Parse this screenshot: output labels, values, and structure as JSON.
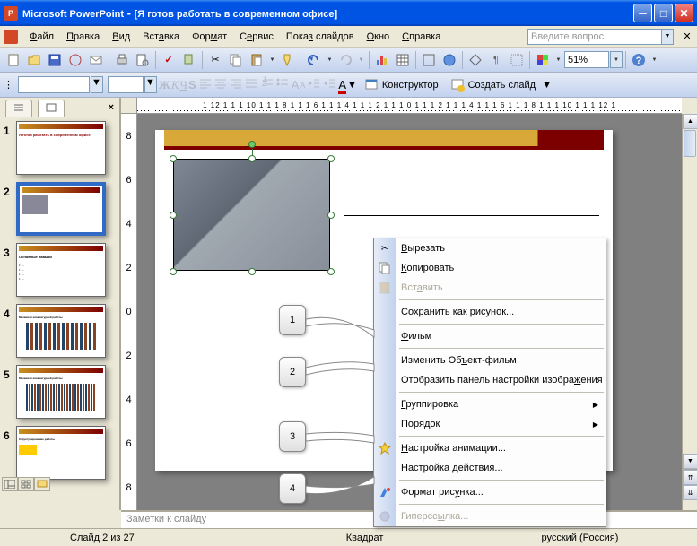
{
  "app": {
    "name": "Microsoft PowerPoint",
    "document": "[Я готов работать в современном офисе]"
  },
  "menu": {
    "file": "Файл",
    "edit": "Правка",
    "view": "Вид",
    "insert": "Вставка",
    "format": "Формат",
    "tools": "Сервис",
    "slideshow": "Показ слайдов",
    "window": "Окно",
    "help": "Справка",
    "ask_placeholder": "Введите вопрос"
  },
  "toolbar": {
    "zoom": "51%",
    "designer": "Конструктор",
    "newslide": "Создать слайд"
  },
  "ruler_h": "1 12 1 1 1 10 1 1 1 8 1 1 1 6 1 1 1 4 1 1 1 2 1 1 1 0 1 1 1 2 1 1 1 4 1 1 1 6 1 1 1 8 1 1 1 10 1 1 1 12 1",
  "ruler_v": [
    "8",
    "6",
    "4",
    "2",
    "0",
    "2",
    "4",
    "6",
    "8"
  ],
  "thumbs": {
    "count": 6,
    "selected": 2
  },
  "context_menu": {
    "cut": "Вырезать",
    "copy": "Копировать",
    "paste": "Вставить",
    "save_as_pic": "Сохранить как рисунок...",
    "movie": "Фильм",
    "change_object": "Изменить Объект-фильм",
    "show_picture_toolbar": "Отобразить панель настройки изображения",
    "grouping": "Группировка",
    "order": "Порядок",
    "custom_animation": "Настройка анимации...",
    "action_settings": "Настройка действия...",
    "format_picture": "Формат рисунка...",
    "hyperlink": "Гиперссылка..."
  },
  "callouts": {
    "c1": "1",
    "c2": "2",
    "c3": "3",
    "c4": "4"
  },
  "notes_placeholder": "Заметки к слайду",
  "status": {
    "slide": "Слайд 2 из 27",
    "shape": "Квадрат",
    "lang": "русский (Россия)"
  }
}
